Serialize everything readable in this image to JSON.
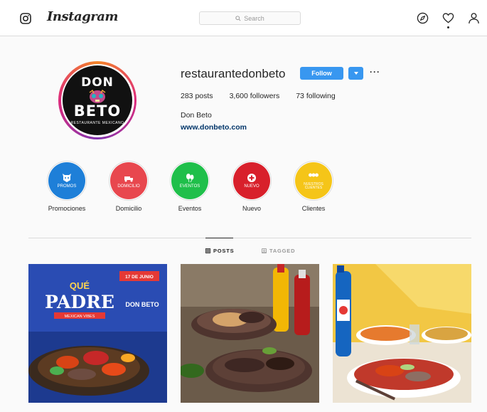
{
  "nav": {
    "wordmark": "Instagram",
    "search_placeholder": "Search"
  },
  "profile": {
    "username": "restaurantedonbeto",
    "follow_label": "Follow",
    "more_label": "···",
    "stats": [
      {
        "value": "283",
        "label": "posts"
      },
      {
        "value": "3,600",
        "label": "followers"
      },
      {
        "value": "73",
        "label": "following"
      }
    ],
    "full_name": "Don Beto",
    "website": "www.donbeto.com",
    "avatar_logo": {
      "line1": "DON",
      "line2": "BETO",
      "line3": "RESTAURANTE MEXICANO"
    }
  },
  "highlights": [
    {
      "label": "Promociones",
      "inner": "PROMOS",
      "color": "#1e7fd8",
      "icon": "dog-icon"
    },
    {
      "label": "Domicilio",
      "inner": "DOMICILIO",
      "color": "#e8474e",
      "icon": "delivery-icon"
    },
    {
      "label": "Eventos",
      "inner": "EVENTOS",
      "color": "#1fbf4a",
      "icon": "balloon-icon"
    },
    {
      "label": "Nuevo",
      "inner": "NUEVO",
      "color": "#d8202b",
      "icon": "plus-icon"
    },
    {
      "label": "Clientes",
      "inner": "NUESTROS CLIENTES",
      "color": "#f5c518",
      "icon": "people-icon"
    }
  ],
  "tabs": [
    {
      "label": "POSTS",
      "icon": "grid-icon",
      "active": true
    },
    {
      "label": "TAGGED",
      "icon": "tag-icon",
      "active": false
    }
  ],
  "posts": [
    {
      "title_top": "QUÉ",
      "title_main": "PADRE",
      "subtitle": "MEXICAN VIBES",
      "date_badge": "17 DE JUNIO",
      "brand": "DON BETO"
    },
    {},
    {}
  ]
}
